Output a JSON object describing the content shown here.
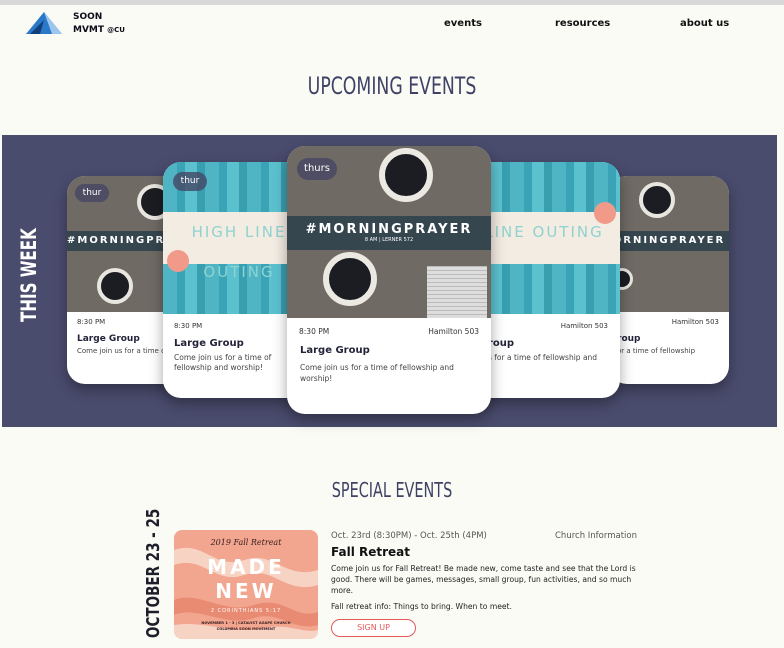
{
  "brand": {
    "name_line1": "SOON",
    "name_line2": "MVMT",
    "suffix": "@CU"
  },
  "nav": {
    "events": "events",
    "resources": "resources",
    "about": "about us"
  },
  "upcoming": {
    "title": "UPCOMING EVENTS"
  },
  "this_week": {
    "label": "THIS WEEK",
    "cards": [
      {
        "day": "thur",
        "time": "8:30 PM",
        "location": "",
        "title": "Large Group",
        "desc": "Come join us for a time of fellowship and worship!",
        "banner": "#MORNINGPRAYER"
      },
      {
        "day": "thur",
        "time": "8:30 PM",
        "location": "",
        "title": "Large Group",
        "desc": "Come join us for a time of fellowship and worship!",
        "banner": "HIGH LINE OUTING"
      },
      {
        "day": "thurs",
        "time": "8:30 PM",
        "location": "Hamilton 503",
        "title": "Large Group",
        "desc": "Come join us for a time of fellowship and worship!",
        "banner": "#MORNINGPRAYER",
        "banner_sub": "8 AM | LERNER 572"
      },
      {
        "day": "",
        "time": "",
        "location": "Hamilton 503",
        "title": "roup",
        "desc": "s for a time of fellowship and",
        "banner": "LINE OUTING"
      },
      {
        "day": "",
        "time": "",
        "location": "Hamilton 503",
        "title": "roup",
        "desc": "or a time of fellowship",
        "banner": "ORNINGPRAYER"
      }
    ]
  },
  "special": {
    "title": "SPECIAL EVENTS",
    "date_label": "OCTOBER 23 - 25",
    "event": {
      "dates": "Oct. 23rd (8:30PM) - Oct. 25th (4PM)",
      "church_info": "Church Information",
      "title": "Fall Retreat",
      "desc": "Come join us for Fall Retreat! Be made new, come taste and see that the Lord is good. There will be games, messages, small group, fun activities, and so much more.",
      "info": "Fall retreat info: Things to bring. When to meet.",
      "signup": "SIGN UP",
      "poster": {
        "top": "2019 Fall Retreat",
        "line1": "MADE",
        "line2": "NEW",
        "verse": "2 CORINTHIANS 5:17",
        "footer1": "NOVEMBER 1 - 3 | CATALYST AGAPE CHURCH",
        "footer2": "COLUMBIA SOON MOVEMENT"
      }
    }
  }
}
